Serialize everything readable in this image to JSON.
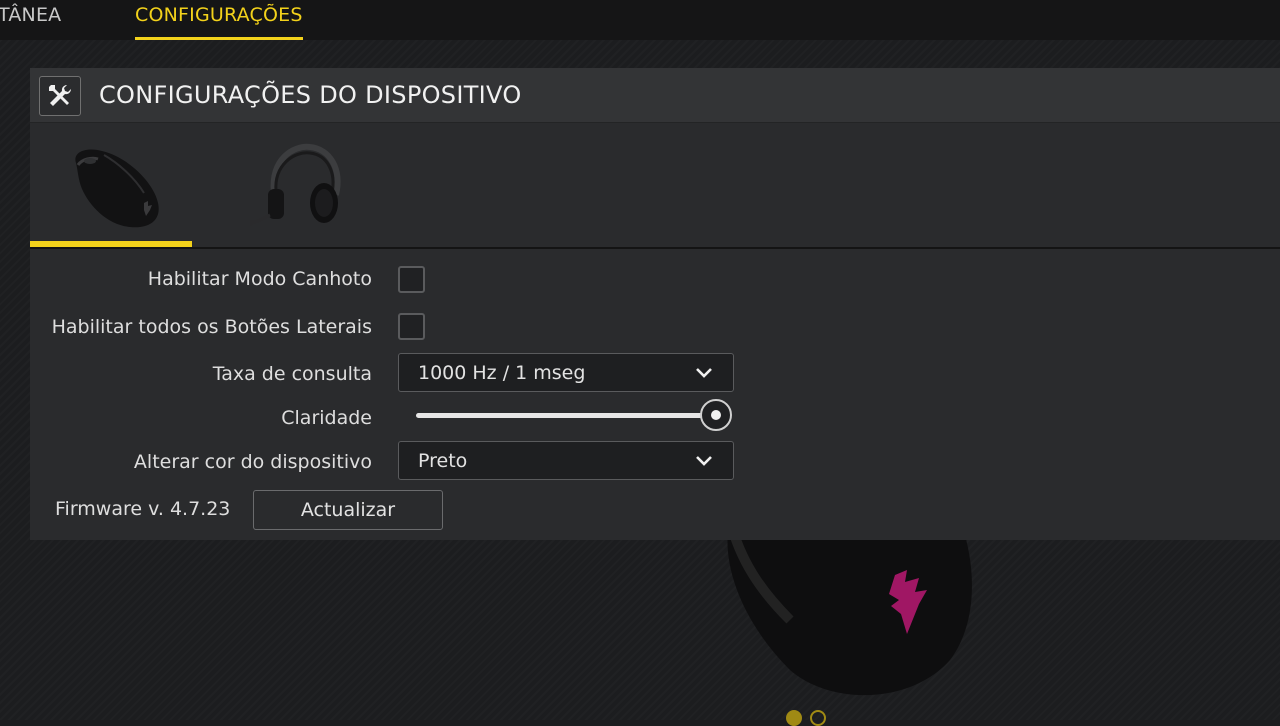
{
  "nav": {
    "prev_tab_label": "TÂNEA",
    "active_tab_label": "CONFIGURAÇÕES"
  },
  "panel": {
    "icon": "tools-icon",
    "title": "CONFIGURAÇÕES DO DISPOSITIVO",
    "device_tabs": [
      {
        "icon": "mouse-icon",
        "selected": true
      },
      {
        "icon": "headset-icon",
        "selected": false
      }
    ]
  },
  "settings": {
    "left_handed_label": "Habilitar Modo Canhoto",
    "left_handed_checked": false,
    "side_buttons_label": "Habilitar todos os Botões Laterais",
    "side_buttons_checked": false,
    "polling_label": "Taxa de consulta",
    "polling_value": "1000 Hz / 1 mseg",
    "brightness_label": "Claridade",
    "brightness_level": 1.0,
    "color_label": "Alterar cor do dispositivo",
    "color_value": "Preto"
  },
  "firmware": {
    "label": "Firmware v. 4.7.23",
    "update_label": "Actualizar"
  },
  "colors": {
    "accent": "#f3d21b",
    "logo": "#b0186e"
  }
}
